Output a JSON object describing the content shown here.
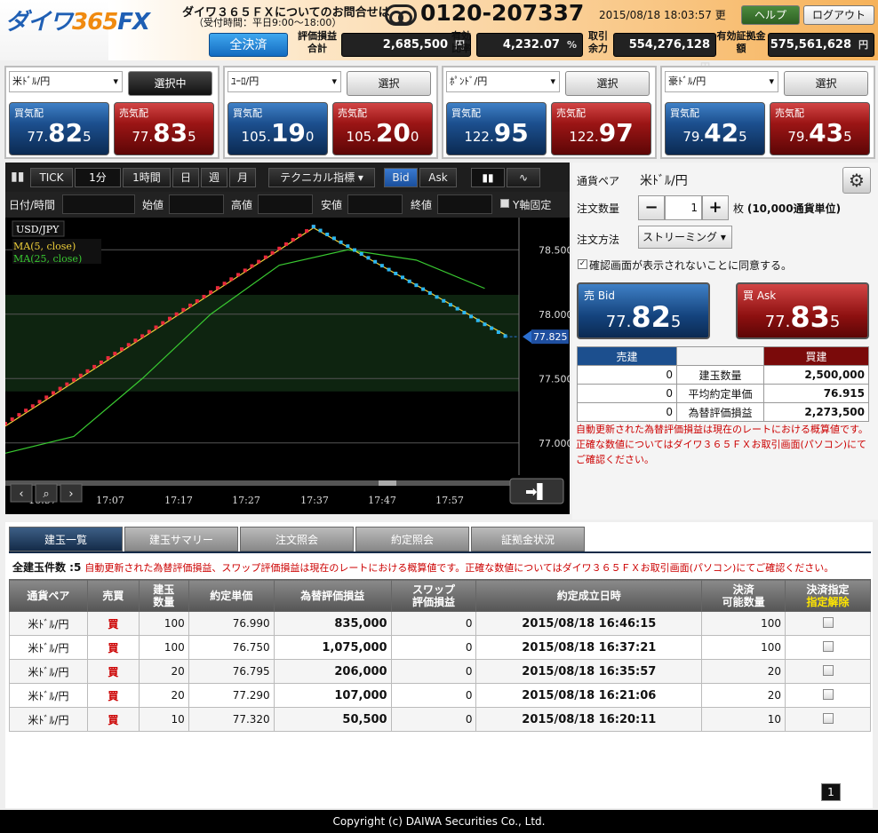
{
  "header": {
    "logo_main": "ダイワ",
    "logo_num": "365",
    "logo_fx": "FX",
    "inquiry": "ダイワ３６５ＦＸについてのお問合せは",
    "hours": "（受付時間：平日9:00～18:00）",
    "tel": "0120-207337",
    "datetime": "2015/08/18 18:03:57 更",
    "help_label": "ヘルプ",
    "logout_label": "ログアウト"
  },
  "summary_bar": {
    "close_all_label": "全決済",
    "pnl_label": "評価損益合計",
    "pnl_value": "2,685,500",
    "pnl_unit": "円",
    "ratio_label": "有効比率",
    "ratio_value": "4,232.07",
    "ratio_unit": "%",
    "margin_avail_label": "取引余力",
    "margin_avail_value": "554,276,128",
    "margin_avail_unit": "円",
    "eff_margin_label": "有効証拠金額",
    "eff_margin_value": "575,561,628",
    "eff_margin_unit": "円"
  },
  "pairs": [
    {
      "name": "米ﾄﾞﾙ/円",
      "select_label": "選択中",
      "active": true,
      "bid_label": "買気配",
      "ask_label": "売気配",
      "bid_a": "77.",
      "bid_b": "82",
      "bid_c": "5",
      "ask_a": "77.",
      "ask_b": "83",
      "ask_c": "5"
    },
    {
      "name": "ﾕｰﾛ/円",
      "select_label": "選択",
      "active": false,
      "bid_label": "買気配",
      "ask_label": "売気配",
      "bid_a": "105.",
      "bid_b": "19",
      "bid_c": "0",
      "ask_a": "105.",
      "ask_b": "20",
      "ask_c": "0"
    },
    {
      "name": "ﾎﾟﾝﾄﾞ/円",
      "select_label": "選択",
      "active": false,
      "bid_label": "買気配",
      "ask_label": "売気配",
      "bid_a": "122.",
      "bid_b": "95",
      "bid_c": "",
      "ask_a": "122.",
      "ask_b": "97",
      "ask_c": ""
    },
    {
      "name": "豪ﾄﾞﾙ/円",
      "select_label": "選択",
      "active": false,
      "bid_label": "買気配",
      "ask_label": "売気配",
      "bid_a": "79.",
      "bid_b": "42",
      "bid_c": "5",
      "ask_a": "79.",
      "ask_b": "43",
      "ask_c": "5"
    }
  ],
  "chart_toolbar": {
    "tick": "TICK",
    "m1": "1分",
    "h1": "1時間",
    "day": "日",
    "week": "週",
    "month": "月",
    "tech": "テクニカル指標",
    "bid": "Bid",
    "ask": "Ask"
  },
  "chart_fields": {
    "date": "日付/時間",
    "open": "始値",
    "high": "高値",
    "low": "安値",
    "close": "終値",
    "yfix": "Y軸固定"
  },
  "chart_data": {
    "type": "line",
    "title": "USD/JPY",
    "legend": [
      "MA(5, close)",
      "MA(25, close)"
    ],
    "x_ticks": [
      "16:57",
      "17:07",
      "17:17",
      "17:27",
      "17:37",
      "17:47",
      "17:57"
    ],
    "y_ticks": [
      78.5,
      78.0,
      77.5,
      77.0
    ],
    "ylim": [
      76.75,
      78.75
    ],
    "current_label": "77.825",
    "current_value": 77.825,
    "price_points": {
      "up_start": [
        0,
        77.15
      ],
      "peak": [
        45,
        78.68
      ],
      "end": [
        73,
        77.83
      ]
    },
    "ma5": {
      "start": [
        0,
        77.13
      ],
      "peak": [
        45,
        78.67
      ],
      "end": [
        73,
        77.84
      ]
    },
    "ma25": [
      [
        0,
        76.92
      ],
      [
        10,
        77.05
      ],
      [
        20,
        77.5
      ],
      [
        30,
        78.0
      ],
      [
        40,
        78.38
      ],
      [
        50,
        78.5
      ],
      [
        60,
        78.42
      ],
      [
        70,
        78.2
      ]
    ],
    "band": [
      77.4,
      78.15
    ],
    "grid": true
  },
  "order": {
    "pair_label": "通貨ペア",
    "pair_value": "米ﾄﾞﾙ/円",
    "qty_label": "注文数量",
    "qty_value": "1",
    "qty_unit": "枚",
    "qty_unit_bold": "(10,000通貨単位)",
    "method_label": "注文方法",
    "method_value": "ストリーミング",
    "agree_label": "確認画面が表示されないことに同意する。",
    "big_bid_label": "売 Bid",
    "big_ask_label": "買 Ask",
    "big_bid_a": "77.",
    "big_bid_b": "82",
    "big_bid_c": "5",
    "big_ask_a": "77.",
    "big_ask_b": "83",
    "big_ask_c": "5",
    "sell_header": "売建",
    "buy_header": "買建",
    "rows": [
      {
        "sell": "0",
        "label": "建玉数量",
        "buy": "2,500,000"
      },
      {
        "sell": "0",
        "label": "平均約定単価",
        "buy": "76.915"
      },
      {
        "sell": "0",
        "label": "為替評価損益",
        "buy": "2,273,500"
      }
    ],
    "notice": "自動更新された為替評価損益は現在のレートにおける概算値です。正確な数値についてはダイワ３６５ＦＸお取引画面(パソコン)にてご確認ください。"
  },
  "tabs": [
    "建玉一覧",
    "建玉サマリー",
    "注文照会",
    "約定照会",
    "証拠金状況"
  ],
  "positions": {
    "count_label": "全建玉件数 :5",
    "notice": "自動更新された為替評価損益、スワップ評価損益は現在のレートにおける概算値です。正確な数値についてはダイワ３６５ＦＸお取引画面(パソコン)にてご確認ください。",
    "headers": [
      "通貨ペア",
      "売買",
      "建玉\n数量",
      "約定単価",
      "為替評価損益",
      "スワップ\n評価損益",
      "約定成立日時",
      "決済\n可能数量",
      "決済指定"
    ],
    "header_sub": "指定解除",
    "rows": [
      [
        "米ﾄﾞﾙ/円",
        "買",
        "100",
        "76.990",
        "835,000",
        "0",
        "2015/08/18 16:46:15",
        "100"
      ],
      [
        "米ﾄﾞﾙ/円",
        "買",
        "100",
        "76.750",
        "1,075,000",
        "0",
        "2015/08/18 16:37:21",
        "100"
      ],
      [
        "米ﾄﾞﾙ/円",
        "買",
        "20",
        "76.795",
        "206,000",
        "0",
        "2015/08/18 16:35:57",
        "20"
      ],
      [
        "米ﾄﾞﾙ/円",
        "買",
        "20",
        "77.290",
        "107,000",
        "0",
        "2015/08/18 16:21:06",
        "20"
      ],
      [
        "米ﾄﾞﾙ/円",
        "買",
        "10",
        "77.320",
        "50,500",
        "0",
        "2015/08/18 16:20:11",
        "10"
      ]
    ]
  },
  "page_number": "1",
  "footer": "Copyright (c) DAIWA Securities Co., Ltd."
}
